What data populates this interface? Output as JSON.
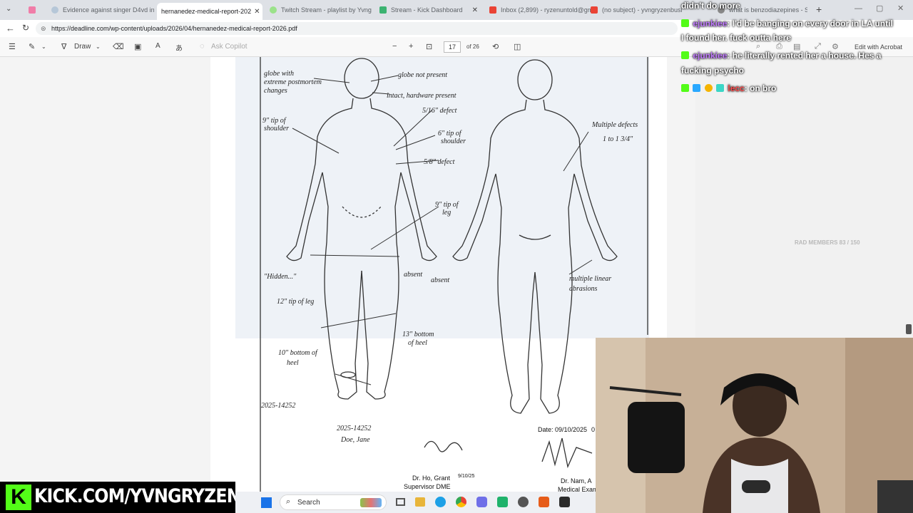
{
  "browser": {
    "tabs": [
      {
        "label": ""
      },
      {
        "label": "Evidence against singer D4vd in"
      },
      {
        "label": "hernanedez-medical-report-202"
      },
      {
        "label": "Twitch Stream - playlist by Yvng"
      },
      {
        "label": "Stream - Kick Dashboard"
      },
      {
        "label": "Inbox (2,899) - ryzenuntold@gm"
      },
      {
        "label": "(no subject) - yvngryzenbusi"
      },
      {
        "label": "what is benzodiazepines - Search"
      }
    ],
    "url": "https://deadline.com/wp-content/uploads/2026/04/hernanedez-medical-report-2026.pdf"
  },
  "pdf_toolbar": {
    "draw_label": "Draw",
    "copilot_label": "Ask Copilot",
    "page_current": "17",
    "page_total": "of 26",
    "edit_label": "Edit with Acrobat"
  },
  "document": {
    "left_notes": [
      "globe with",
      "extreme postmortem",
      "changes",
      "9\" tip of",
      "shoulder",
      "\"Hidden...\"",
      "12\" tip of leg",
      "10\" bottom of",
      "heel",
      "2025-14252"
    ],
    "front_notes": [
      "globe not present",
      "intact, hardware present",
      "5/16\" defect",
      "6\" tip of",
      "shoulder",
      "5/8\" defect",
      "9\" tip of",
      "leg",
      "absent",
      "absent",
      "13\" bottom",
      "of heel",
      "2025-14252",
      "Doe, Jane"
    ],
    "back_notes": [
      "Multiple defects",
      "1 to 1 3/4\"",
      "multiple linear",
      "abrasions"
    ],
    "date": "Date: 09/10/2025",
    "date_suffix": "0",
    "sig1_name": "Dr. Ho, Grant",
    "sig1_title": "Supervisor DME",
    "sig1_date": "9/10/25",
    "sig2_name": "Dr. Nam, A",
    "sig2_title": "Medical Exam"
  },
  "chat": {
    "top_line": "didn't do more",
    "messages": [
      {
        "user": "ejunkiee",
        "text": ": I'd be banging on every door in LA until"
      },
      {
        "user": "",
        "text": "I found her. fuck outta here"
      },
      {
        "user": "ejunkiee",
        "text": ": he literally rented her a house. Hes a"
      },
      {
        "user": "",
        "text": "fucking psycho"
      },
      {
        "user": "lecc",
        "text": ": on bro"
      }
    ],
    "goal": "RAD MEMBERS 83 / 150"
  },
  "taskbar": {
    "search_label": "Search"
  },
  "overlay": {
    "kick_url": "KICK.COM/YVNGRYZEN"
  },
  "colors": {
    "kick_green": "#53fc18",
    "accent": "#1a73e8"
  }
}
